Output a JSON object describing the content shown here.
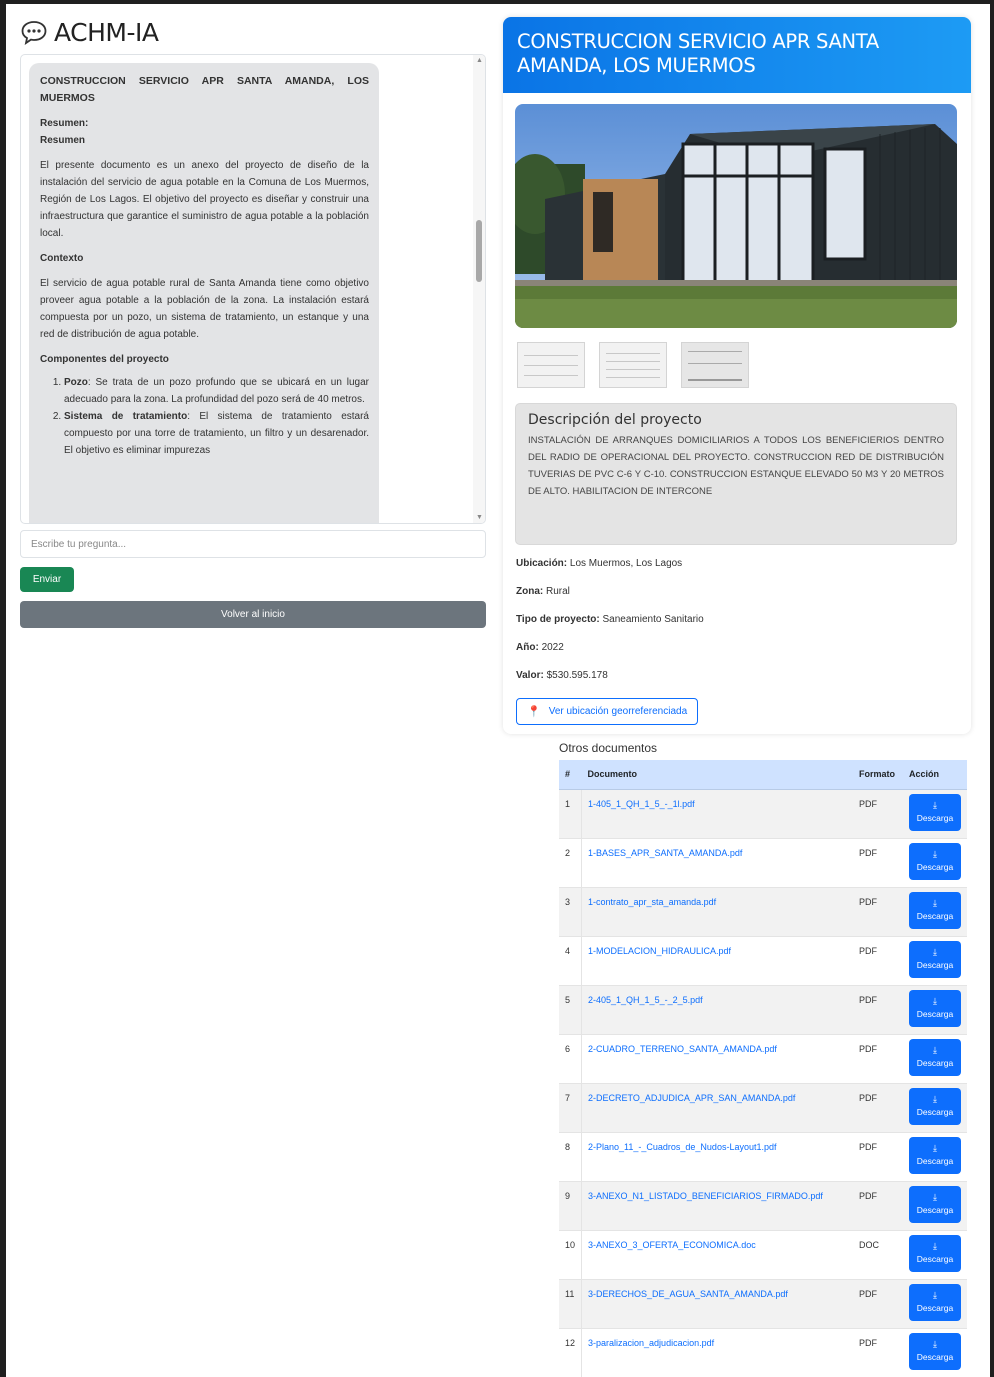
{
  "app": {
    "title": "ACHM-IA",
    "icon": "chat-bubble-icon"
  },
  "chat": {
    "message": {
      "title": "CONSTRUCCION SERVICIO APR SANTA AMANDA, LOS MUERMOS",
      "resumen_label_1": "Resumen:",
      "resumen_label_2": "Resumen",
      "resumen_text": "El presente documento es un anexo del proyecto de diseño de la instalación del servicio de agua potable en la Comuna de Los Muermos, Región de Los Lagos. El objetivo del proyecto es diseñar y construir una infraestructura que garantice el suministro de agua potable a la población local.",
      "contexto_label": "Contexto",
      "contexto_text": "El servicio de agua potable rural de Santa Amanda tiene como objetivo proveer agua potable a la población de la zona. La instalación estará compuesta por un pozo, un sistema de tratamiento, un estanque y una red de distribución de agua potable.",
      "componentes_label": "Componentes del proyecto",
      "components": [
        {
          "name": "Pozo",
          "text": ": Se trata de un pozo profundo que se ubicará en un lugar adecuado para la zona. La profundidad del pozo será de 40 metros."
        },
        {
          "name": "Sistema de tratamiento",
          "text": ": El sistema de tratamiento estará compuesto por una torre de tratamiento, un filtro y un desarenador. El objetivo es eliminar impurezas"
        }
      ]
    },
    "input_placeholder": "Escribe tu pregunta...",
    "send_label": "Enviar",
    "back_label": "Volver al inicio"
  },
  "project": {
    "title": "CONSTRUCCION SERVICIO APR SANTA AMANDA, LOS MUERMOS",
    "description_title": "Descripción del proyecto",
    "description": "INSTALACIÓN DE ARRANQUES DOMICILIARIOS A TODOS LOS BENEFICIERIOS DENTRO DEL RADIO DE OPERACIONAL DEL PROYECTO. CONSTRUCCION RED DE DISTRIBUCIÓN TUVERIAS DE PVC C-6 Y C-10. CONSTRUCCION ESTANQUE ELEVADO 50 M3 Y 20 METROS DE ALTO. HABILITACION DE INTERCONE",
    "location_label": "Ubicación:",
    "location": "Los Muermos, Los Lagos",
    "zone_label": "Zona:",
    "zone": "Rural",
    "type_label": "Tipo de proyecto:",
    "type": "Saneamiento Sanitario",
    "year_label": "Año:",
    "year": "2022",
    "value_label": "Valor:",
    "value": "$530.595.178",
    "geo_button": "Ver ubicación georreferenciada"
  },
  "documents": {
    "title": "Otros documentos",
    "headers": {
      "num": "#",
      "doc": "Documento",
      "format": "Formato",
      "action": "Acción"
    },
    "download_label": "Descarga",
    "rows": [
      {
        "num": "1",
        "name": "1-405_1_QH_1_5_-_1l.pdf",
        "format": "PDF"
      },
      {
        "num": "2",
        "name": "1-BASES_APR_SANTA_AMANDA.pdf",
        "format": "PDF"
      },
      {
        "num": "3",
        "name": "1-contrato_apr_sta_amanda.pdf",
        "format": "PDF"
      },
      {
        "num": "4",
        "name": "1-MODELACION_HIDRAULICA.pdf",
        "format": "PDF"
      },
      {
        "num": "5",
        "name": "2-405_1_QH_1_5_-_2_5.pdf",
        "format": "PDF"
      },
      {
        "num": "6",
        "name": "2-CUADRO_TERRENO_SANTA_AMANDA.pdf",
        "format": "PDF"
      },
      {
        "num": "7",
        "name": "2-DECRETO_ADJUDICA_APR_SAN_AMANDA.pdf",
        "format": "PDF"
      },
      {
        "num": "8",
        "name": "2-Plano_11_-_Cuadros_de_Nudos-Layout1.pdf",
        "format": "PDF"
      },
      {
        "num": "9",
        "name": "3-ANEXO_N1_LISTADO_BENEFICIARIOS_FIRMADO.pdf",
        "format": "PDF"
      },
      {
        "num": "10",
        "name": "3-ANEXO_3_OFERTA_ECONOMICA.doc",
        "format": "DOC"
      },
      {
        "num": "11",
        "name": "3-DERECHOS_DE_AGUA_SANTA_AMANDA.pdf",
        "format": "PDF"
      },
      {
        "num": "12",
        "name": "3-paralizacion_adjudicacion.pdf",
        "format": "PDF"
      }
    ]
  }
}
